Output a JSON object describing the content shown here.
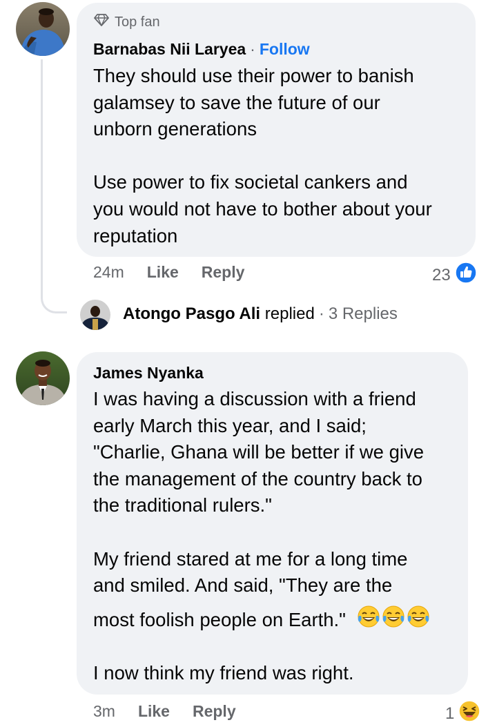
{
  "comments": [
    {
      "badge": "Top fan",
      "author": "Barnabas Nii Laryea",
      "separator": "·",
      "follow_label": "Follow",
      "lines": [
        "They should use their power to banish",
        "galamsey to save the future of our",
        "unborn generations",
        "",
        "Use power to fix societal cankers and",
        "you would not have to bother about your",
        "reputation"
      ],
      "time": "24m",
      "like_label": "Like",
      "reply_label": "Reply",
      "reaction_count": "23",
      "reaction_icon": "like-thumb-icon"
    },
    {
      "author": "James Nyanka",
      "lines": [
        "I was having a discussion with a friend",
        "early March this year, and I said;",
        "\"Charlie, Ghana will be better if we give",
        "the management of the country back to",
        "the traditional rulers.\"",
        "",
        "My friend stared at me for a long time",
        "and smiled. And said, \"They are the",
        "most foolish people on Earth.\"",
        "",
        "I now think my friend was right."
      ],
      "emoji": [
        "tears-of-joy-icon",
        "tears-of-joy-icon",
        "tears-of-joy-icon"
      ],
      "time": "3m",
      "like_label": "Like",
      "reply_label": "Reply",
      "reaction_count": "1",
      "reaction_icon": "haha-icon"
    }
  ],
  "reply_summary": {
    "name": "Atongo Pasgo Ali",
    "text": "replied",
    "separator": "·",
    "count": "3 Replies"
  },
  "colors": {
    "bubble": "#f0f2f5",
    "link_blue": "#1877f2",
    "secondary_text": "#65676b",
    "primary_text": "#050505",
    "thread_line": "#dfe1e6"
  }
}
